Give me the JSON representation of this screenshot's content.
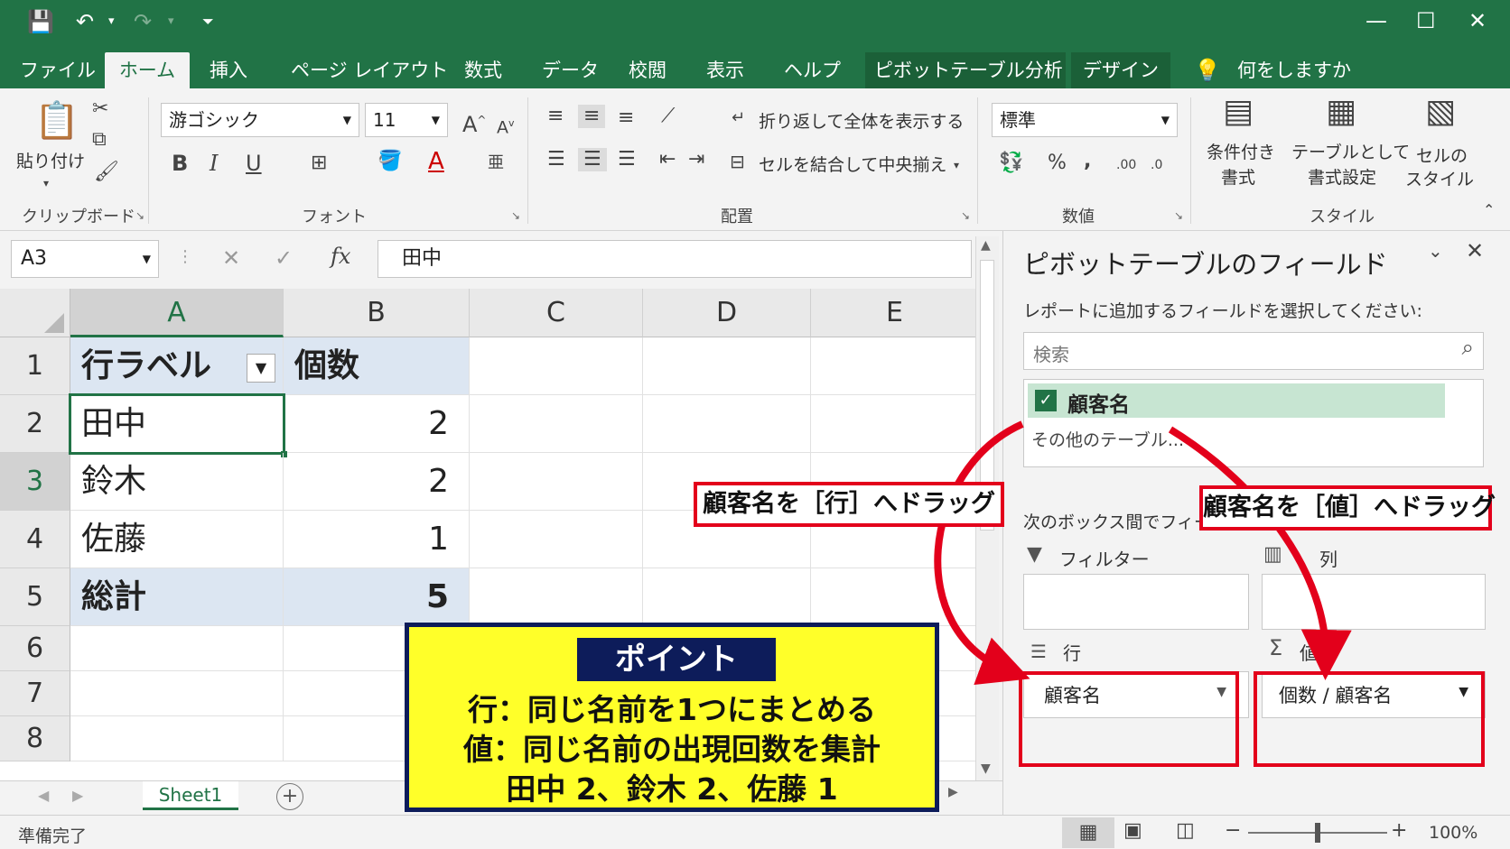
{
  "ribbon_tabs": [
    "ファイル",
    "ホーム",
    "挿入",
    "ページ レイアウト",
    "数式",
    "データ",
    "校閲",
    "表示",
    "ヘルプ",
    "ピボットテーブル分析",
    "デザイン"
  ],
  "tell_me": "何をしますか",
  "clipboard": {
    "paste": "貼り付け",
    "group": "クリップボード"
  },
  "font": {
    "name": "游ゴシック",
    "size": "11",
    "group": "フォント"
  },
  "alignment": {
    "wrap": "折り返して全体を表示する",
    "merge": "セルを結合して中央揃え",
    "group": "配置"
  },
  "number": {
    "format": "標準",
    "group": "数値"
  },
  "styles": {
    "conditional_1": "条件付き",
    "conditional_2": "書式",
    "table_1": "テーブルとして",
    "table_2": "書式設定",
    "cell_1": "セルの",
    "cell_2": "スタイル",
    "group": "スタイル"
  },
  "formula_bar": {
    "name_box": "A3",
    "fx": "fx",
    "content": "田中"
  },
  "columns": [
    "A",
    "B",
    "C",
    "D",
    "E"
  ],
  "rows": [
    "1",
    "2",
    "3",
    "4",
    "5",
    "6",
    "7",
    "8"
  ],
  "table": {
    "header_label": "行ラベル",
    "header_count": "個数",
    "body": [
      {
        "name": "田中",
        "count": "2"
      },
      {
        "name": "鈴木",
        "count": "2"
      },
      {
        "name": "佐藤",
        "count": "1"
      }
    ],
    "total_label": "総計",
    "total_count": "5"
  },
  "sheet_tab": "Sheet1",
  "status": {
    "ready": "準備完了",
    "zoom": "100%"
  },
  "pivot_pane": {
    "title": "ピボットテーブルのフィールド",
    "subtitle": "レポートに追加するフィールドを選択してください:",
    "search_placeholder": "検索",
    "field_name": "顧客名",
    "other_tables": "その他のテーブル...",
    "drag_instruction": "次のボックス間でフィールドをドラッグしてください:",
    "filter_label": "フィルター",
    "columns_label": "列",
    "rows_label": "行",
    "values_label": "値",
    "rows_item": "顧客名",
    "values_item": "個数 / 顧客名"
  },
  "callouts": {
    "to_rows": "顧客名を［行］へドラッグ",
    "to_values": "顧客名を［値］へドラッグ"
  },
  "point": {
    "title": "ポイント",
    "line1": "行：同じ名前を1つにまとめる",
    "line2": "値：同じ名前の出現回数を集計",
    "line3": "田中 2、鈴木 2、佐藤 1"
  },
  "colors": {
    "excel_green": "#217346",
    "annotation_red": "#e3001b",
    "point_yellow": "#ffff29",
    "point_navy": "#0d1c5a"
  }
}
